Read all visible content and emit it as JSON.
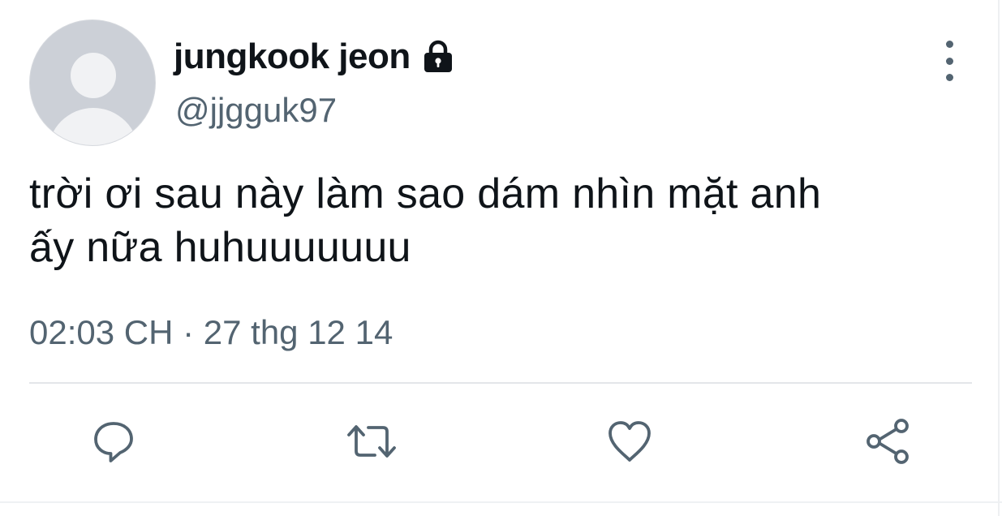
{
  "user": {
    "display_name": "jungkook jeon",
    "handle": "@jjgguk97",
    "protected_icon": "lock-icon",
    "avatar_icon": "default-avatar"
  },
  "tweet": {
    "text_line_1": "trời ơi sau này làm sao dám nhìn mặt anh",
    "text_line_2": "ấy nữa huhuuuuuuu",
    "timestamp": "02:03 CH · 27 thg 12 14"
  },
  "actions": [
    {
      "name": "reply",
      "icon": "reply-icon"
    },
    {
      "name": "retweet",
      "icon": "retweet-icon"
    },
    {
      "name": "like",
      "icon": "heart-icon"
    },
    {
      "name": "share",
      "icon": "share-icon"
    }
  ],
  "menu": {
    "icon": "more-vertical-icon"
  },
  "colors": {
    "primary_text": "#0f1419",
    "secondary_text": "#536471",
    "divider": "#e3e6e9",
    "avatar_bg": "#ccd0d7"
  }
}
